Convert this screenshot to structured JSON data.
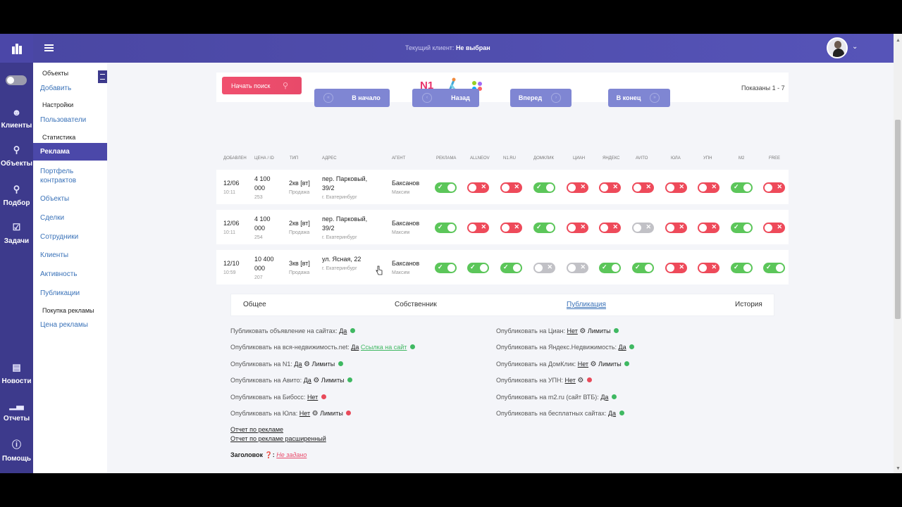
{
  "topbar": {
    "client_label": "Текущий клиент:",
    "client_value": "Не выбран"
  },
  "rail": {
    "items": [
      {
        "label": "Клиенты",
        "icon": "user-icon"
      },
      {
        "label": "Объекты",
        "icon": "key-icon"
      },
      {
        "label": "Подбор",
        "icon": "search-icon"
      },
      {
        "label": "Задачи",
        "icon": "calendar-icon"
      },
      {
        "label": "Новости",
        "icon": "news-icon"
      },
      {
        "label": "Отчеты",
        "icon": "chart-icon"
      },
      {
        "label": "Помощь",
        "icon": "help-icon"
      }
    ]
  },
  "menu": {
    "sec_objects": "Объекты",
    "add": "Добавить",
    "sec_settings": "Настройки",
    "users": "Пользователи",
    "sec_stats": "Статистика",
    "ads": "Реклама",
    "portfolio": "Портфель контрактов",
    "objects": "Объекты",
    "deals": "Сделки",
    "staff": "Сотрудники",
    "clients": "Клиенты",
    "activity": "Активность",
    "publications": "Публикации",
    "sec_buy": "Покупка рекламы",
    "price": "Цена рекламы"
  },
  "search": {
    "start_label": "Начать поиск",
    "shown": "Показаны 1 - 7",
    "n1_logo": "N1"
  },
  "pagination": {
    "first": "В начало",
    "back": "Назад",
    "next": "Вперед",
    "last": "В конец"
  },
  "table": {
    "headers": [
      "ДОБАВЛЕН",
      "ЦЕНА / ID",
      "ТИП",
      "АДРЕС",
      "АГЕНТ",
      "РЕКЛАМА",
      "ALLNEOV",
      "N1.RU",
      "ДОМКЛИК",
      "ЦИАН",
      "ЯНДЕКС",
      "AVITO",
      "ЮЛА",
      "УПН",
      "M2",
      "FREE"
    ],
    "rows": [
      {
        "date": "12/06",
        "time": "10:11",
        "price1": "4 100",
        "price2": "000",
        "id": "253",
        "type": "2кв [вт]",
        "deal": "Продажа",
        "addr1": "пер. Парковый,",
        "addr2": "39/2",
        "city": "г. Екатеринбург",
        "agent": "Баксанов",
        "agent2": "Максим",
        "toggles": [
          "on",
          "off",
          "off",
          "on",
          "off",
          "off",
          "off",
          "off",
          "off",
          "on",
          "off"
        ]
      },
      {
        "date": "12/06",
        "time": "10:11",
        "price1": "4 100",
        "price2": "000",
        "id": "254",
        "type": "2кв [вт]",
        "deal": "Продажа",
        "addr1": "пер. Парковый,",
        "addr2": "39/2",
        "city": "г. Екатеринбург",
        "agent": "Баксанов",
        "agent2": "Максим",
        "toggles": [
          "on",
          "off",
          "off",
          "on",
          "off",
          "off",
          "dis",
          "off",
          "off",
          "on",
          "off"
        ]
      },
      {
        "date": "12/10",
        "time": "10:59",
        "price1": "10 400",
        "price2": "000",
        "id": "207",
        "type": "3кв [вт]",
        "deal": "Продажа",
        "addr1": "ул. Ясная, 22",
        "addr2": "",
        "city": "г. Екатеринбург",
        "agent": "Баксанов",
        "agent2": "Максим",
        "toggles": [
          "on",
          "on",
          "on",
          "dis",
          "dis",
          "on",
          "on",
          "off",
          "off",
          "on",
          "on"
        ]
      }
    ]
  },
  "tabs": {
    "general": "Общее",
    "owner": "Собственник",
    "publication": "Публикация",
    "history": "История"
  },
  "pub": {
    "left": [
      {
        "label": "Публиковать объявление на сайтах:",
        "value": "Да",
        "status": "g"
      },
      {
        "label": "Опубликовать на вся-недвижимость.net:",
        "value": "Да",
        "link": "Ссылка на сайт",
        "status": "g"
      },
      {
        "label": "Опубликовать на N1:",
        "value": "Да",
        "limits": "Лимиты",
        "status": "g"
      },
      {
        "label": "Опубликовать на Авито:",
        "value": "Да",
        "limits": "Лимиты",
        "status": "g"
      },
      {
        "label": "Опубликовать на Бибосс:",
        "value": "Нет",
        "status": "r"
      },
      {
        "label": "Опубликовать на Юла:",
        "value": "Нет",
        "limits": "Лимиты",
        "status": "r"
      }
    ],
    "right": [
      {
        "label": "Опубликовать на Циан:",
        "value": "Нет",
        "limits": "Лимиты",
        "status": "g"
      },
      {
        "label": "Опубликовать на Яндекс.Недвижимость:",
        "value": "Да",
        "status": "g"
      },
      {
        "label": "Опубликовать на ДомКлик:",
        "value": "Нет",
        "limits": "Лимиты",
        "status": "g"
      },
      {
        "label": "Опубликовать на УПН:",
        "value": "Нет",
        "gear": true,
        "status": "r"
      },
      {
        "label": "Опубликовать на m2.ru (сайт ВТБ):",
        "value": "Да",
        "status": "g"
      },
      {
        "label": "Опубликовать на бесплатных сайтах:",
        "value": "Да",
        "status": "g"
      }
    ],
    "report1": "Отчет по рекламе",
    "report2": "Отчет по рекламе расширенный",
    "title_label": "Заголовок",
    "title_value": "Не задано"
  }
}
